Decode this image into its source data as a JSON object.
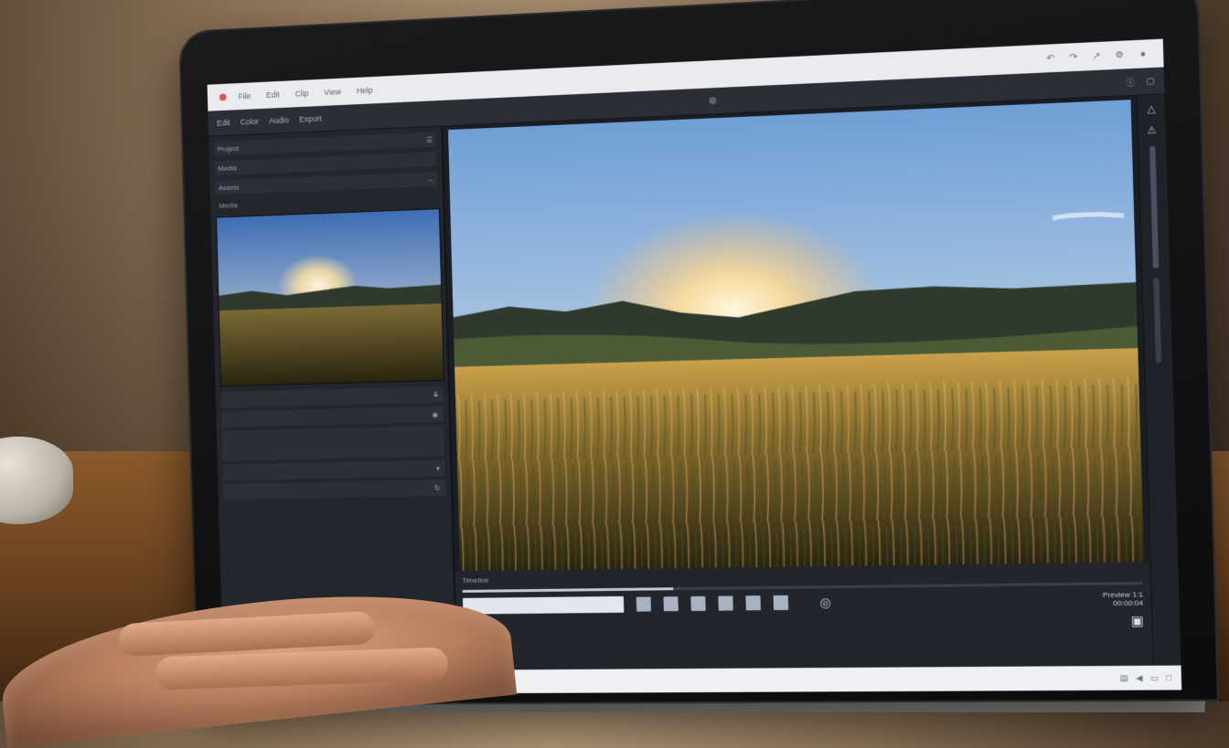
{
  "app": {
    "menu": [
      "File",
      "Edit",
      "Clip",
      "View",
      "Help"
    ],
    "toolbar_tabs": [
      "Edit",
      "Color",
      "Audio",
      "Export"
    ]
  },
  "left_panel": {
    "project_rows": [
      "Project",
      "Media",
      "Assets"
    ],
    "thumb_label": "Media"
  },
  "timeline": {
    "label": "Timeline",
    "progress": 0.32,
    "info_line1": "Preview 1:1",
    "info_line2": "00:00:04"
  },
  "colors": {
    "sky_top": "#6f9fd6",
    "sky_horizon": "#f3e0b0",
    "sun": "#fff3d0",
    "grass_dark": "#2a2410",
    "grass_light": "#c9a04a",
    "hills": "#2f3a2c"
  }
}
